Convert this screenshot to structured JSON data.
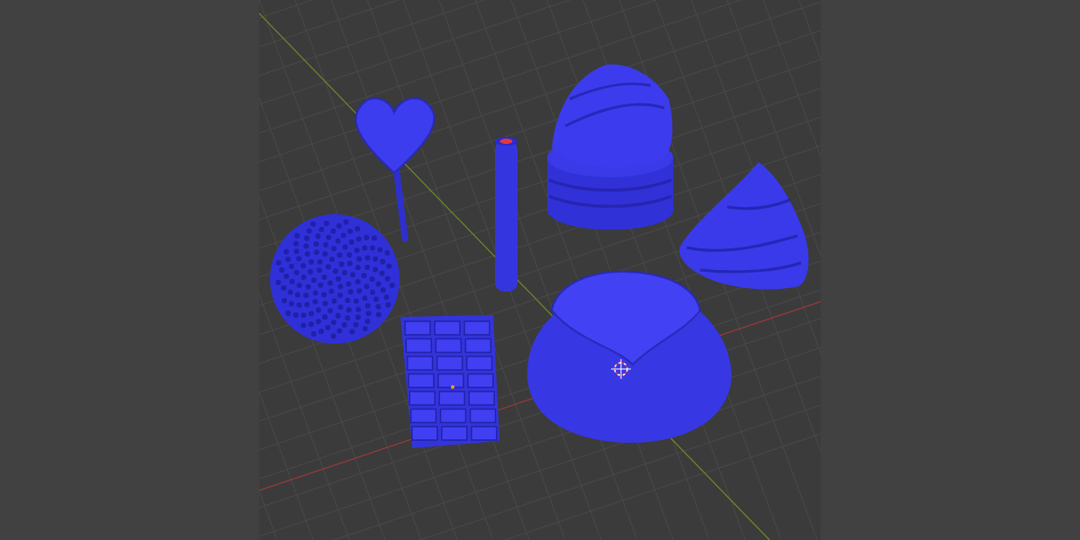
{
  "viewport": {
    "objects": [
      {
        "kind": "lollipop"
      },
      {
        "kind": "cylinder"
      },
      {
        "kind": "cupcake"
      },
      {
        "kind": "swirl"
      },
      {
        "kind": "sprinkle-ball"
      },
      {
        "kind": "chocolate-bar"
      },
      {
        "kind": "pudding"
      }
    ]
  }
}
